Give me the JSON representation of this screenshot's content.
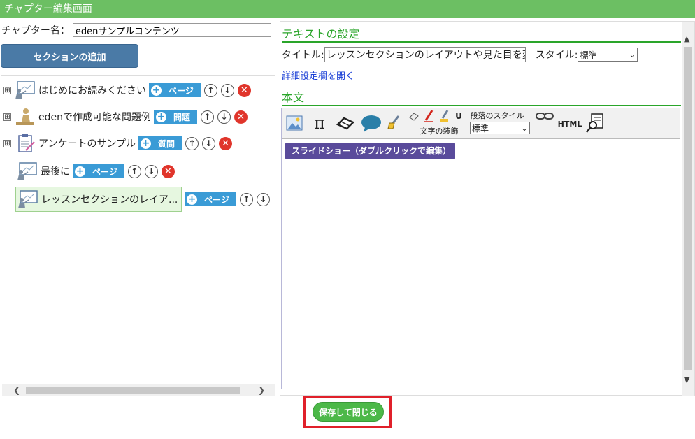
{
  "window": {
    "title": "チャプター編集画面"
  },
  "chapter": {
    "label": "チャプター名：",
    "value": "edenサンプルコンテンツ"
  },
  "add_section_label": "セクションの追加",
  "tree": {
    "nodes": [
      {
        "label": "はじめにお読みください",
        "add_label": "ページ"
      },
      {
        "label": "edenで作成可能な問題例",
        "add_label": "問題"
      },
      {
        "label": "アンケートのサンプル",
        "add_label": "質問"
      },
      {
        "label": "最後に",
        "add_label": "ページ"
      },
      {
        "label": "レッスンセクションのレイア...",
        "add_label": "ページ"
      }
    ]
  },
  "text_settings": {
    "heading": "テキストの設定",
    "title_label": "タイトル:",
    "title_value": "レッスンセクションのレイアウトや見た目を変更で",
    "style_label": "スタイル:",
    "style_value": "標準",
    "details_link": "詳細設定欄を開く"
  },
  "body": {
    "heading": "本文",
    "decoration_label": "文字の装飾",
    "paragraph_style_label": "段落のスタイル",
    "paragraph_style_value": "標準",
    "html_label": "HTML",
    "underline_label": "U",
    "slideshow_label": "スライドショー（ダブルクリックで編集）"
  },
  "save_label": "保存して閉じる",
  "icons": {
    "tree_plus": "⊞",
    "arrow_up": "↑",
    "arrow_down": "↓",
    "delete": "✕",
    "add": "+",
    "scroll_left": "❮",
    "scroll_right": "❯",
    "scroll_up": "▲",
    "scroll_down": "▼",
    "dropdown": "⌄"
  },
  "colors": {
    "titlebar": "#6cbf63",
    "section_heading": "#2aa52a",
    "add_button": "#3a9bd6",
    "delete": "#e0352b",
    "slideshow": "#5a4b9b",
    "save_button": "#4cb848",
    "highlight_frame": "#e0202a"
  }
}
